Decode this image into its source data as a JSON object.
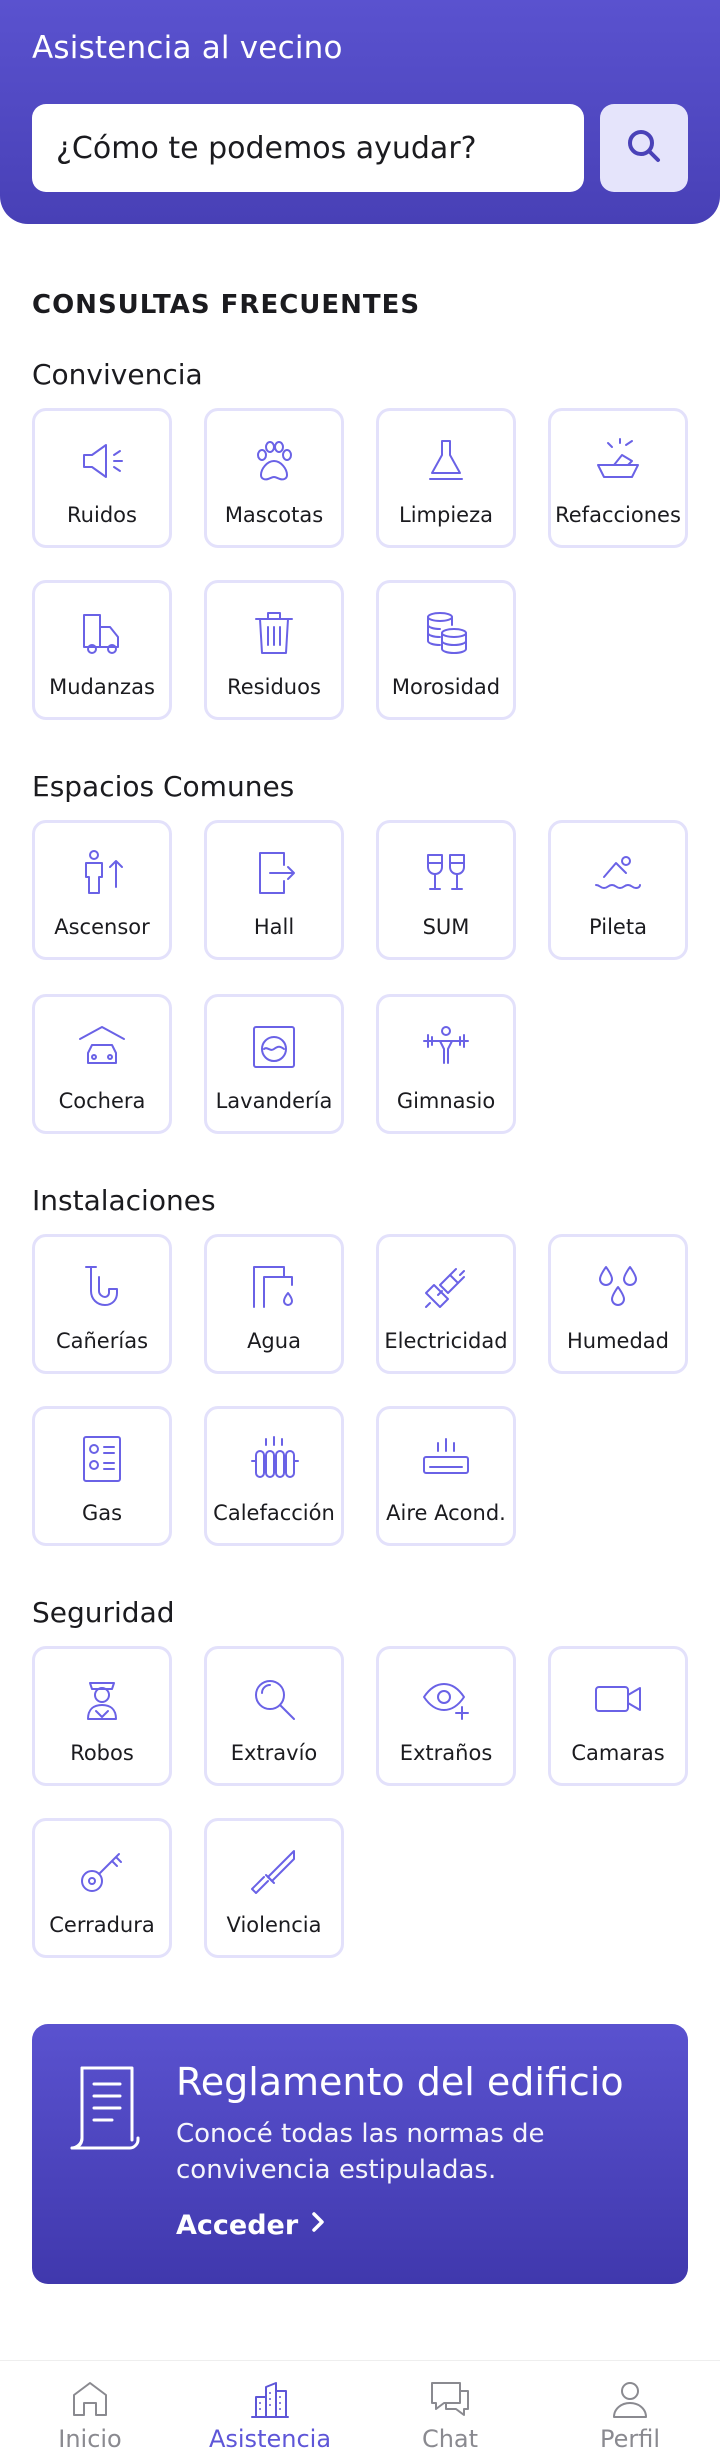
{
  "header": {
    "title": "Asistencia al vecino",
    "search_placeholder": "¿Cómo te podemos ayudar?",
    "search_icon": "search-icon"
  },
  "faq": {
    "title": "CONSULTAS FRECUENTES",
    "groups": [
      {
        "title": "Convivencia",
        "items": [
          {
            "label": "Ruidos",
            "icon": "megaphone-icon"
          },
          {
            "label": "Mascotas",
            "icon": "paw-icon"
          },
          {
            "label": "Limpieza",
            "icon": "plunger-icon"
          },
          {
            "label": "Refacciones",
            "icon": "trowel-icon"
          },
          {
            "label": "Mudanzas",
            "icon": "moving-truck-icon"
          },
          {
            "label": "Residuos",
            "icon": "trash-icon"
          },
          {
            "label": "Morosidad",
            "icon": "coins-icon"
          }
        ]
      },
      {
        "title": "Espacios Comunes",
        "items": [
          {
            "label": "Ascensor",
            "icon": "elevator-icon"
          },
          {
            "label": "Hall",
            "icon": "door-enter-icon"
          },
          {
            "label": "SUM",
            "icon": "glasses-toast-icon"
          },
          {
            "label": "Pileta",
            "icon": "swimmer-icon"
          },
          {
            "label": "Cochera",
            "icon": "garage-car-icon"
          },
          {
            "label": "Lavandería",
            "icon": "washing-machine-icon"
          },
          {
            "label": "Gimnasio",
            "icon": "weightlifter-icon"
          }
        ]
      },
      {
        "title": "Instalaciones",
        "items": [
          {
            "label": "Cañerías",
            "icon": "pipe-icon"
          },
          {
            "label": "Agua",
            "icon": "faucet-icon"
          },
          {
            "label": "Electricidad",
            "icon": "plug-icon"
          },
          {
            "label": "Humedad",
            "icon": "drops-icon"
          },
          {
            "label": "Gas",
            "icon": "gas-stove-icon"
          },
          {
            "label": "Calefacción",
            "icon": "radiator-icon"
          },
          {
            "label": "Aire Acond.",
            "icon": "air-conditioner-icon"
          }
        ]
      },
      {
        "title": "Seguridad",
        "items": [
          {
            "label": "Robos",
            "icon": "thief-icon"
          },
          {
            "label": "Extravío",
            "icon": "magnifier-icon"
          },
          {
            "label": "Extraños",
            "icon": "eye-plus-icon"
          },
          {
            "label": "Camaras",
            "icon": "video-camera-icon"
          },
          {
            "label": "Cerradura",
            "icon": "key-icon"
          },
          {
            "label": "Violencia",
            "icon": "knife-icon"
          }
        ]
      }
    ]
  },
  "banner": {
    "title": "Reglamento del edificio",
    "description": "Conocé todas las normas de convivencia estipuladas.",
    "link_label": "Acceder",
    "icon": "document-scroll-icon"
  },
  "tabs": [
    {
      "label": "Inicio",
      "icon": "home-icon",
      "active": false
    },
    {
      "label": "Asistencia",
      "icon": "buildings-icon",
      "active": true
    },
    {
      "label": "Chat",
      "icon": "chat-icon",
      "active": false
    },
    {
      "label": "Perfil",
      "icon": "user-icon",
      "active": false
    }
  ],
  "colors": {
    "brand": "#5a52cf",
    "icon_accent": "#6a62e6",
    "tile_border": "#e3e1fb",
    "tab_active": "#5e56d8",
    "tab_inactive": "#8a8a90"
  }
}
